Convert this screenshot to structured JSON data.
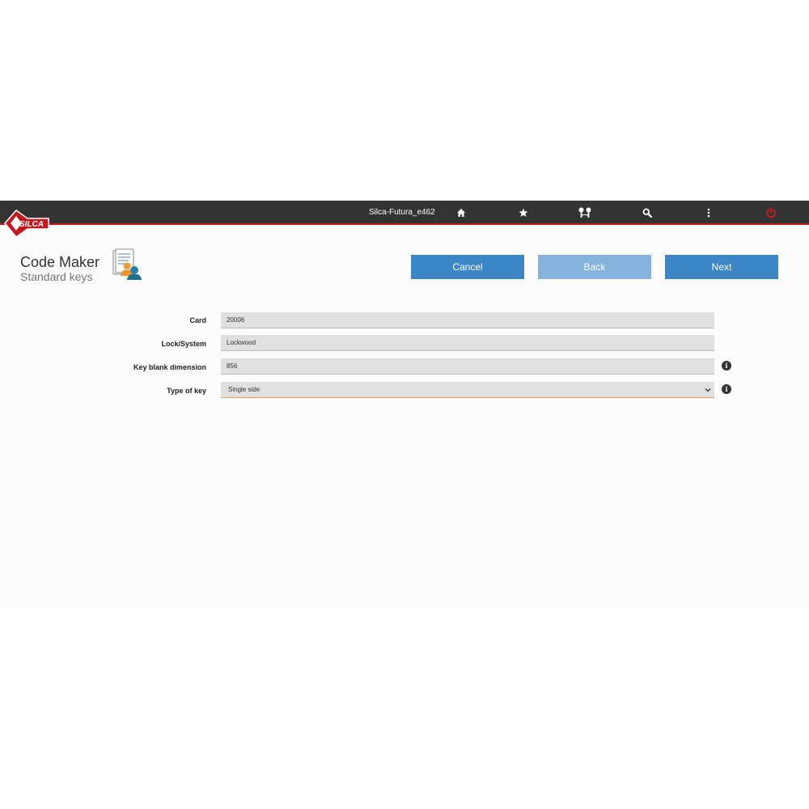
{
  "topbar": {
    "device_name": "Silca-Futura_e462",
    "icons": [
      "home-icon",
      "star-icon",
      "keys-icon",
      "search-icon",
      "more-vertical-icon",
      "power-icon"
    ],
    "accent_color": "#c8161d",
    "background_color": "#333333"
  },
  "logo": {
    "text": "SILCA"
  },
  "header": {
    "title": "Code Maker",
    "subtitle": "Standard keys",
    "icon": "code-maker-document-user-icon"
  },
  "actions": {
    "cancel_label": "Cancel",
    "back_label": "Back",
    "next_label": "Next",
    "primary_color": "#3d86c8",
    "disabled_color": "#86b3dd"
  },
  "form": {
    "card": {
      "label": "Card",
      "value": "20006"
    },
    "lock_system": {
      "label": "Lock/System",
      "value": "Lockwood"
    },
    "key_blank_dimension": {
      "label": "Key blank dimension",
      "value": "856"
    },
    "type_of_key": {
      "label": "Type of key",
      "value": "Single side"
    }
  }
}
